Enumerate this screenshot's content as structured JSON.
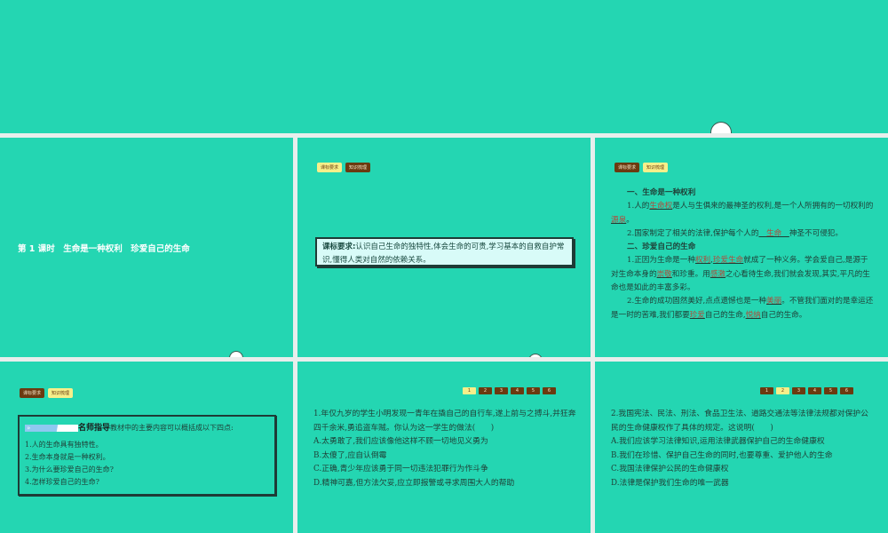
{
  "slide1": {
    "title": "第 1 课时　生命是一种权利　珍爱自己的生命"
  },
  "tabs": {
    "a": "课标要求",
    "b": "知识梳理"
  },
  "slide2": {
    "label": "课标要求:",
    "text": "认识自己生命的独特性,体会生命的可贵,学习基本的自救自护常识,懂得人类对自然的依赖关系。"
  },
  "slide3": {
    "h1": "一、生命是一种权利",
    "p1": [
      "1.人的",
      "生命权",
      "是人与生俱来的最神圣的权利,是一个人所拥有的一切权利的",
      "源泉",
      "。"
    ],
    "p2": [
      "2.国家制定了相关的法律,保护每个人的",
      "　生命　",
      "神圣不可侵犯。"
    ],
    "h2": "二、珍爱自己的生命",
    "p3": [
      "1.正因为生命是一种",
      "权利",
      ",",
      "珍爱生命",
      "就成了一种义务。学会爱自己,是源于对生命本身的",
      "崇敬",
      "和珍重。用",
      "感激",
      "之心看待生命,我们就会发现,其实,平凡的生命也是如此的丰富多彩。"
    ],
    "p4": [
      "2.生命的成功固然美好,点点遗憾也是一种",
      "美丽",
      "。不管我们面对的是幸运还是一时的苦难,我们都要",
      "珍爱",
      "自己的生命,",
      "悦纳",
      "自己的生命。"
    ]
  },
  "slide4": {
    "guide_title": "名师指导",
    "intro": "教材中的主要内容可以概括成以下四点:",
    "items": [
      "1.人的生命具有独特性。",
      "2.生命本身就是一种权利。",
      "3.为什么要珍爱自己的生命?",
      "4.怎样珍爱自己的生命?"
    ]
  },
  "pager": [
    "1",
    "2",
    "3",
    "4",
    "5",
    "6"
  ],
  "slide5": {
    "q": "1.年仅九岁的学生小明发现一青年在撬自己的自行车,遂上前与之搏斗,并狂奔四千余米,勇追盗车贼。你认为这一学生的做法(　　)",
    "options": [
      "A.太勇敢了,我们应该像他这样不顾一切地见义勇为",
      "B.太傻了,应自认倒霉",
      "C.正确,青少年应该勇于同一切违法犯罪行为作斗争",
      "D.精神可嘉,但方法欠妥,应立即报警或寻求周围大人的帮助"
    ]
  },
  "slide6": {
    "q": "2.我国宪法、民法、刑法、食品卫生法、道路交通法等法律法规都对保护公民的生命健康权作了具体的规定。这说明(　　)",
    "options": [
      "A.我们应该学习法律知识,运用法律武器保护自己的生命健康权",
      "B.我们在珍惜、保护自己生命的同时,也要尊重、爱护他人的生命",
      "C.我国法律保护公民的生命健康权",
      "D.法律是保护我们生命的唯一武器"
    ]
  }
}
